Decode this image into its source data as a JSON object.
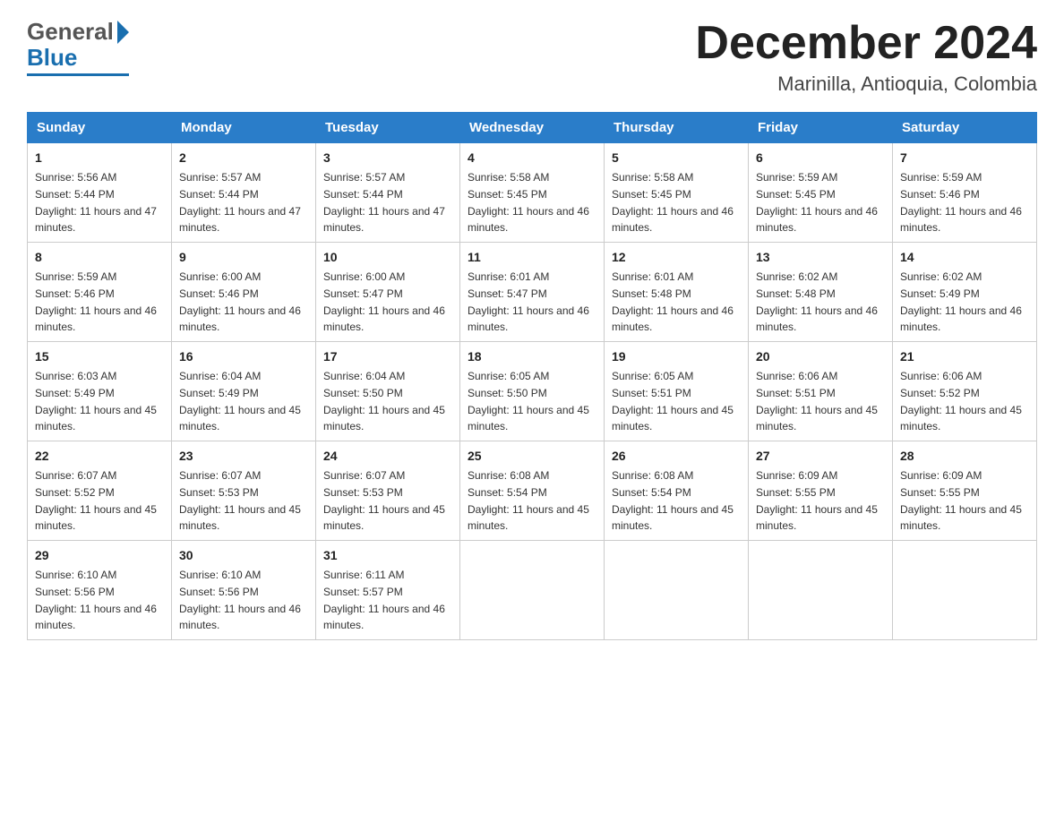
{
  "header": {
    "logo_general": "General",
    "logo_blue": "Blue",
    "month_title": "December 2024",
    "location": "Marinilla, Antioquia, Colombia"
  },
  "weekdays": [
    "Sunday",
    "Monday",
    "Tuesday",
    "Wednesday",
    "Thursday",
    "Friday",
    "Saturday"
  ],
  "weeks": [
    [
      {
        "day": "1",
        "sunrise": "5:56 AM",
        "sunset": "5:44 PM",
        "daylight": "11 hours and 47 minutes."
      },
      {
        "day": "2",
        "sunrise": "5:57 AM",
        "sunset": "5:44 PM",
        "daylight": "11 hours and 47 minutes."
      },
      {
        "day": "3",
        "sunrise": "5:57 AM",
        "sunset": "5:44 PM",
        "daylight": "11 hours and 47 minutes."
      },
      {
        "day": "4",
        "sunrise": "5:58 AM",
        "sunset": "5:45 PM",
        "daylight": "11 hours and 46 minutes."
      },
      {
        "day": "5",
        "sunrise": "5:58 AM",
        "sunset": "5:45 PM",
        "daylight": "11 hours and 46 minutes."
      },
      {
        "day": "6",
        "sunrise": "5:59 AM",
        "sunset": "5:45 PM",
        "daylight": "11 hours and 46 minutes."
      },
      {
        "day": "7",
        "sunrise": "5:59 AM",
        "sunset": "5:46 PM",
        "daylight": "11 hours and 46 minutes."
      }
    ],
    [
      {
        "day": "8",
        "sunrise": "5:59 AM",
        "sunset": "5:46 PM",
        "daylight": "11 hours and 46 minutes."
      },
      {
        "day": "9",
        "sunrise": "6:00 AM",
        "sunset": "5:46 PM",
        "daylight": "11 hours and 46 minutes."
      },
      {
        "day": "10",
        "sunrise": "6:00 AM",
        "sunset": "5:47 PM",
        "daylight": "11 hours and 46 minutes."
      },
      {
        "day": "11",
        "sunrise": "6:01 AM",
        "sunset": "5:47 PM",
        "daylight": "11 hours and 46 minutes."
      },
      {
        "day": "12",
        "sunrise": "6:01 AM",
        "sunset": "5:48 PM",
        "daylight": "11 hours and 46 minutes."
      },
      {
        "day": "13",
        "sunrise": "6:02 AM",
        "sunset": "5:48 PM",
        "daylight": "11 hours and 46 minutes."
      },
      {
        "day": "14",
        "sunrise": "6:02 AM",
        "sunset": "5:49 PM",
        "daylight": "11 hours and 46 minutes."
      }
    ],
    [
      {
        "day": "15",
        "sunrise": "6:03 AM",
        "sunset": "5:49 PM",
        "daylight": "11 hours and 45 minutes."
      },
      {
        "day": "16",
        "sunrise": "6:04 AM",
        "sunset": "5:49 PM",
        "daylight": "11 hours and 45 minutes."
      },
      {
        "day": "17",
        "sunrise": "6:04 AM",
        "sunset": "5:50 PM",
        "daylight": "11 hours and 45 minutes."
      },
      {
        "day": "18",
        "sunrise": "6:05 AM",
        "sunset": "5:50 PM",
        "daylight": "11 hours and 45 minutes."
      },
      {
        "day": "19",
        "sunrise": "6:05 AM",
        "sunset": "5:51 PM",
        "daylight": "11 hours and 45 minutes."
      },
      {
        "day": "20",
        "sunrise": "6:06 AM",
        "sunset": "5:51 PM",
        "daylight": "11 hours and 45 minutes."
      },
      {
        "day": "21",
        "sunrise": "6:06 AM",
        "sunset": "5:52 PM",
        "daylight": "11 hours and 45 minutes."
      }
    ],
    [
      {
        "day": "22",
        "sunrise": "6:07 AM",
        "sunset": "5:52 PM",
        "daylight": "11 hours and 45 minutes."
      },
      {
        "day": "23",
        "sunrise": "6:07 AM",
        "sunset": "5:53 PM",
        "daylight": "11 hours and 45 minutes."
      },
      {
        "day": "24",
        "sunrise": "6:07 AM",
        "sunset": "5:53 PM",
        "daylight": "11 hours and 45 minutes."
      },
      {
        "day": "25",
        "sunrise": "6:08 AM",
        "sunset": "5:54 PM",
        "daylight": "11 hours and 45 minutes."
      },
      {
        "day": "26",
        "sunrise": "6:08 AM",
        "sunset": "5:54 PM",
        "daylight": "11 hours and 45 minutes."
      },
      {
        "day": "27",
        "sunrise": "6:09 AM",
        "sunset": "5:55 PM",
        "daylight": "11 hours and 45 minutes."
      },
      {
        "day": "28",
        "sunrise": "6:09 AM",
        "sunset": "5:55 PM",
        "daylight": "11 hours and 45 minutes."
      }
    ],
    [
      {
        "day": "29",
        "sunrise": "6:10 AM",
        "sunset": "5:56 PM",
        "daylight": "11 hours and 46 minutes."
      },
      {
        "day": "30",
        "sunrise": "6:10 AM",
        "sunset": "5:56 PM",
        "daylight": "11 hours and 46 minutes."
      },
      {
        "day": "31",
        "sunrise": "6:11 AM",
        "sunset": "5:57 PM",
        "daylight": "11 hours and 46 minutes."
      },
      null,
      null,
      null,
      null
    ]
  ],
  "labels": {
    "sunrise": "Sunrise:",
    "sunset": "Sunset:",
    "daylight": "Daylight:"
  }
}
